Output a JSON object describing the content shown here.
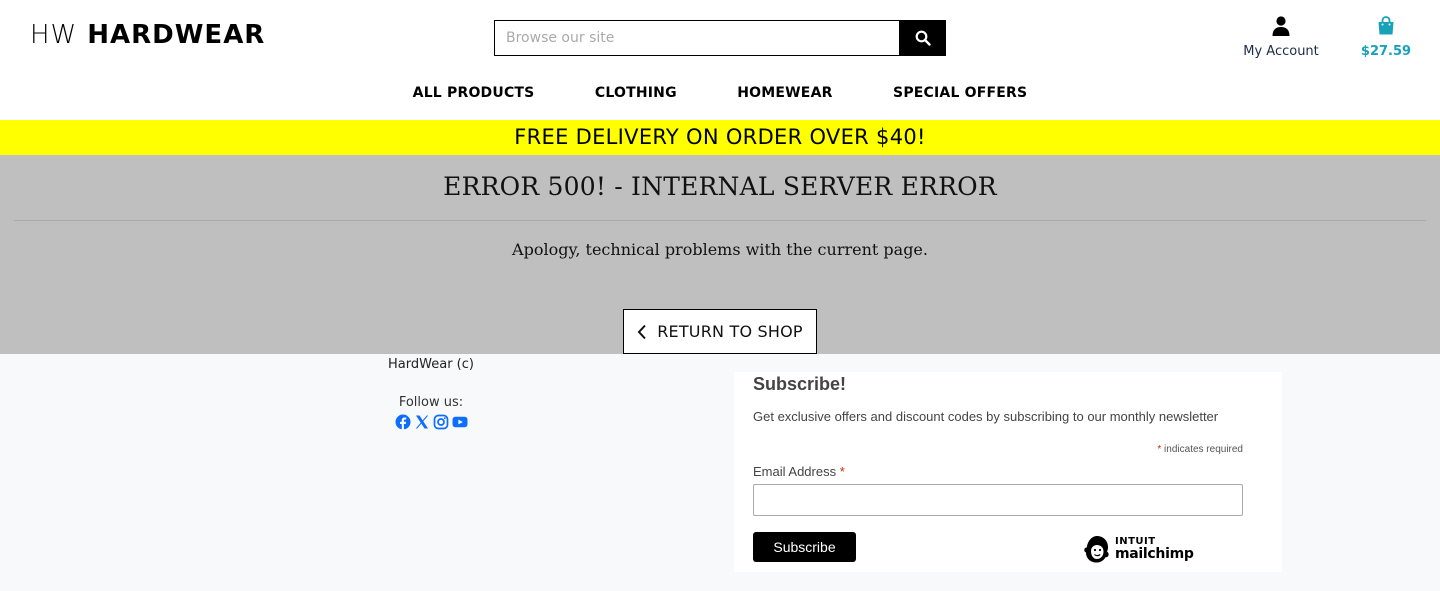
{
  "header": {
    "logo_mark": "HW",
    "logo_name": "HARDWEAR",
    "search_placeholder": "Browse our site",
    "account_label": "My Account",
    "bag_total": "$27.59"
  },
  "nav": {
    "items": [
      "ALL PRODUCTS",
      "CLOTHING",
      "HOMEWEAR",
      "SPECIAL OFFERS"
    ]
  },
  "banner": {
    "text": "FREE DELIVERY ON ORDER OVER $40!",
    "color": "#ffff00"
  },
  "error": {
    "title": "ERROR 500! - INTERNAL SERVER ERROR",
    "message": "Apology, technical problems with the current page.",
    "return_label": "RETURN TO SHOP"
  },
  "footer": {
    "copyright": "HardWear (c)",
    "follow_label": "Follow us:",
    "socials": [
      "facebook-icon",
      "x-icon",
      "instagram-icon",
      "youtube-icon"
    ]
  },
  "subscribe": {
    "title": "Subscribe!",
    "description": "Get exclusive offers and discount codes by subscribing to our monthly newsletter",
    "asterisk": "*",
    "required_note": " indicates required",
    "email_label": "Email Address ",
    "button_label": "Subscribe",
    "brand_top": "INTUIT",
    "brand_name": "mailchimp"
  },
  "colors": {
    "accent": "#17a2b8",
    "social": "#0d6efd",
    "error_bg": "#bfbfbf"
  }
}
